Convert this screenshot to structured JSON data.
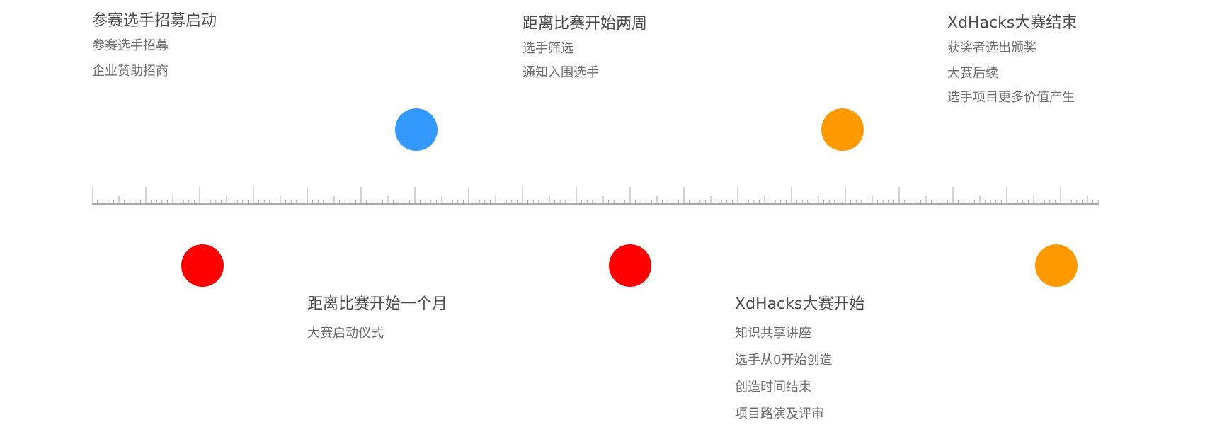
{
  "timeline": {
    "top_events": [
      {
        "title": "参赛选手招募启动",
        "items": [
          "参赛选手招募",
          "企业赞助招商"
        ]
      },
      {
        "title": "距离比赛开始两周",
        "items": [
          "选手筛选",
          "通知入围选手"
        ]
      },
      {
        "title": "XdHacks大赛结束",
        "items": [
          "获奖者选出颁奖",
          "大赛后续",
          "选手项目更多价值产生"
        ]
      }
    ],
    "bottom_events": [
      {
        "title": "距离比赛开始一个月",
        "items": [
          "大赛启动仪式"
        ]
      },
      {
        "title": "XdHacks大赛开始",
        "items": [
          "知识共享讲座",
          "选手从0开始创造",
          "创造时间结束",
          "项目路演及评审"
        ]
      }
    ],
    "colors": {
      "blue": "#3399ff",
      "orange": "#ff9900",
      "red": "#ff0000",
      "ruler": "#aaaaaa"
    }
  }
}
